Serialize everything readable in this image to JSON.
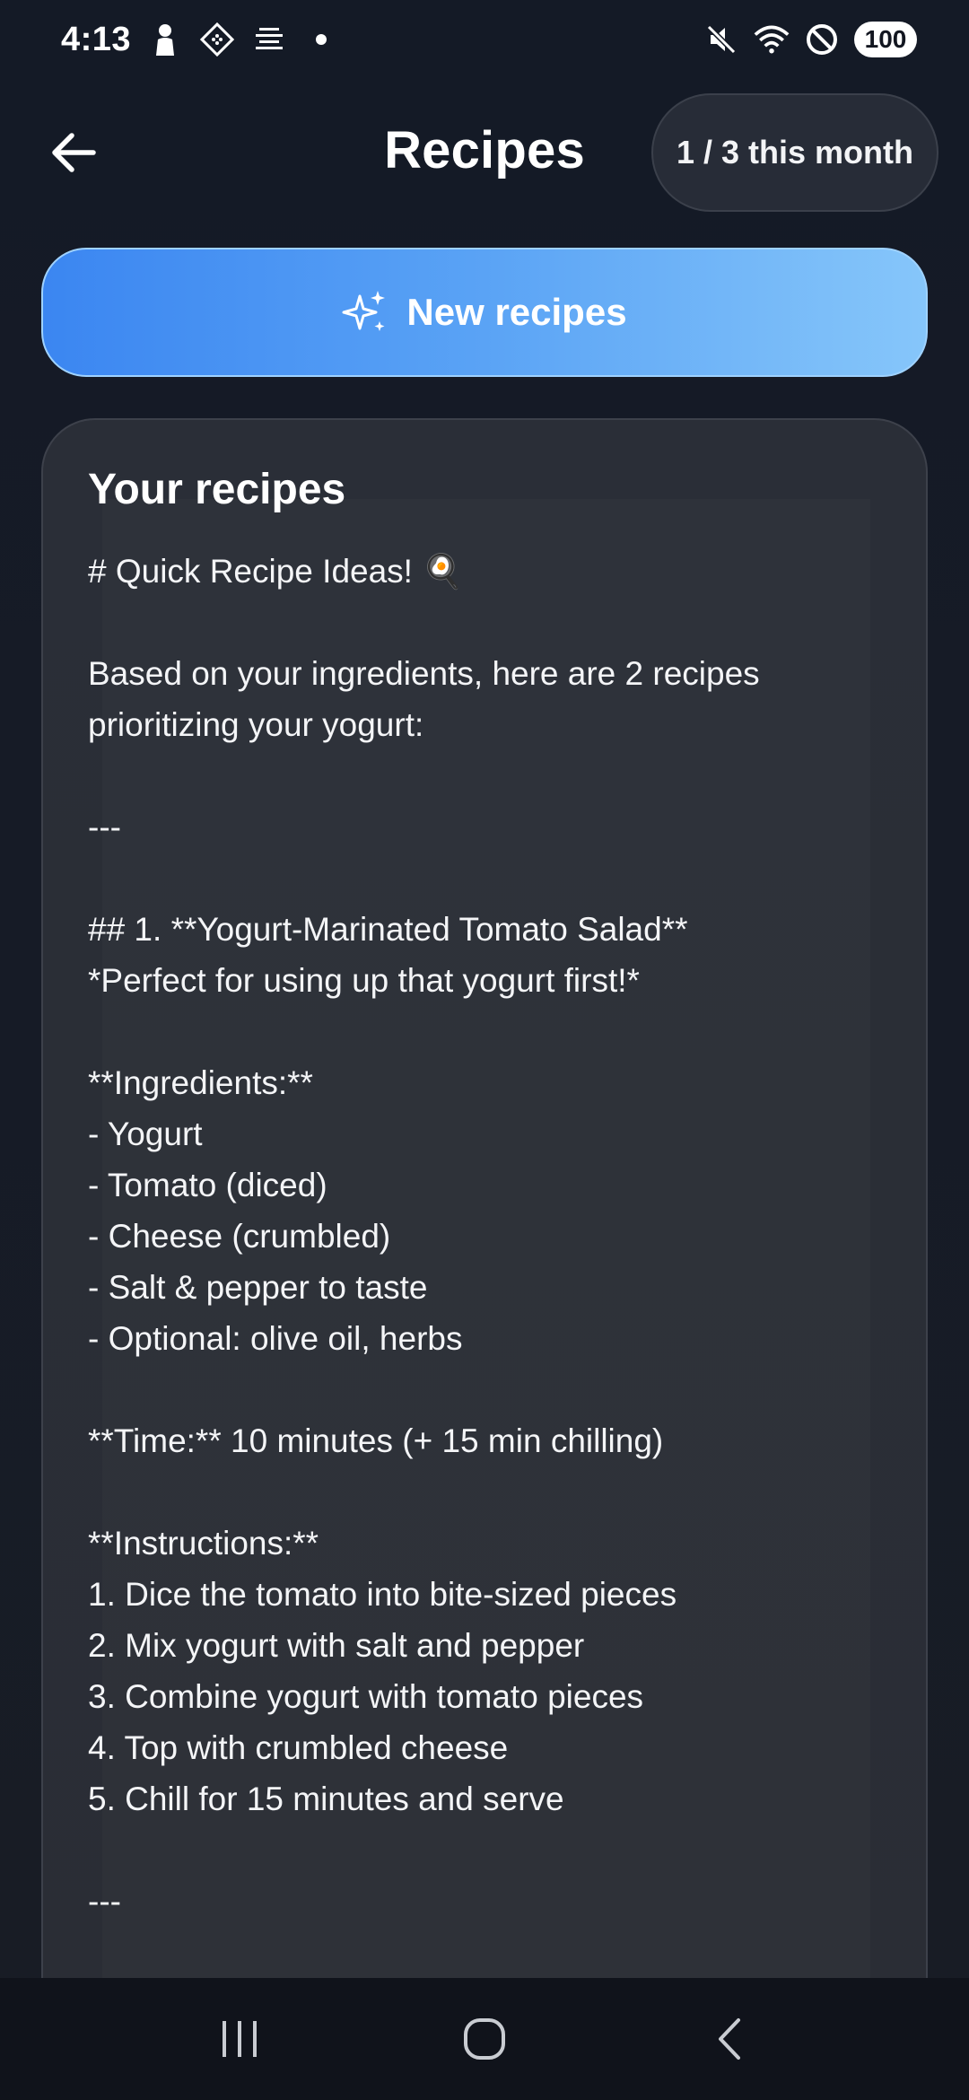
{
  "status_bar": {
    "time": "4:13",
    "battery": "100",
    "left_icons": [
      "person-icon",
      "cube-icon",
      "list-icon",
      "dot-icon"
    ],
    "right_icons": [
      "mute-icon",
      "wifi-icon",
      "do-not-disturb-icon",
      "battery-icon"
    ]
  },
  "header": {
    "title": "Recipes",
    "quota": "1 / 3 this month"
  },
  "actions": {
    "new_recipes_label": "New recipes"
  },
  "card": {
    "title": "Your recipes",
    "lines": [
      "# Quick Recipe Ideas! 🍳",
      "",
      "Based on your ingredients, here are 2 recipes",
      "prioritizing your yogurt:",
      "",
      "---",
      "",
      "## 1. **Yogurt-Marinated Tomato Salad**",
      "*Perfect for using up that yogurt first!*",
      "",
      "**Ingredients:**",
      "- Yogurt",
      "- Tomato (diced)",
      "- Cheese (crumbled)",
      "- Salt & pepper to taste",
      "- Optional: olive oil, herbs",
      "",
      "**Time:** 10 minutes (+ 15 min chilling)",
      "",
      "**Instructions:**",
      "1. Dice the tomato into bite-sized pieces",
      "2. Mix yogurt with salt and pepper",
      "3. Combine yogurt with tomato pieces",
      "4. Top with crumbled cheese",
      "5. Chill for 15 minutes and serve",
      "",
      "---"
    ]
  },
  "colors": {
    "background": "#151a25",
    "card": "#2a2e37",
    "button_gradient_start": "#3b86f1",
    "button_gradient_end": "#86c6fa",
    "nav_bar": "#10131b"
  }
}
